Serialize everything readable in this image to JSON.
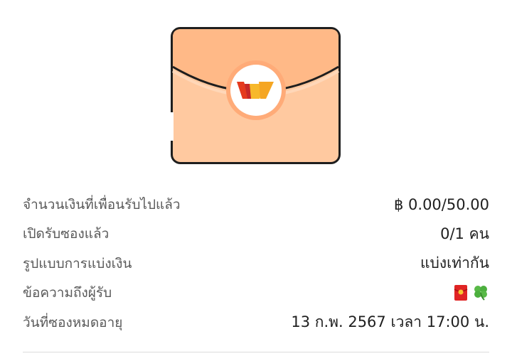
{
  "details": {
    "rows": [
      {
        "label": "จำนวนเงินที่เพื่อนรับไปแล้ว",
        "value": "฿ 0.00/50.00"
      },
      {
        "label": "เปิดรับซองแล้ว",
        "value": "0/1 คน"
      },
      {
        "label": "รูปแบบการแบ่งเงิน",
        "value": "แบ่งเท่ากัน"
      },
      {
        "label": "ข้อความถึงผู้รับ",
        "icons": [
          "red-envelope-icon",
          "four-leaf-clover-icon"
        ]
      },
      {
        "label": "วันที่ซองหมดอายุ",
        "value": "13 ก.พ. 2567 เวลา 17:00 น."
      }
    ]
  },
  "colors": {
    "envelope_body": "#ffc9a0",
    "envelope_flap": "#ffb987",
    "envelope_outline": "#1e1e1e",
    "seal_ring": "#ffab78",
    "logo_red": "#e53a1e",
    "logo_yellow": "#f7b82a",
    "divider": "#dcdcdc"
  }
}
